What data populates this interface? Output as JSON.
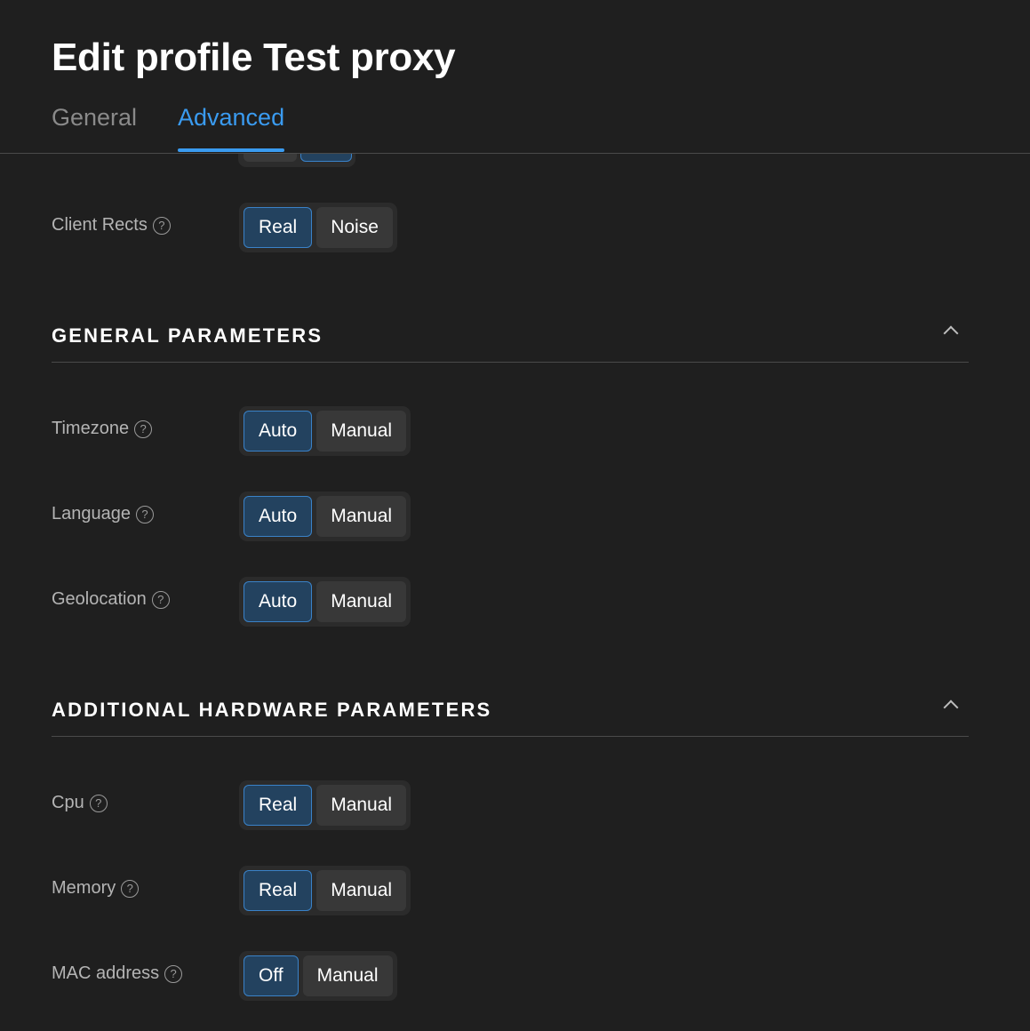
{
  "header": {
    "title": "Edit profile Test proxy",
    "tabs": [
      {
        "label": "General",
        "active": false
      },
      {
        "label": "Advanced",
        "active": true
      }
    ]
  },
  "colors": {
    "accent": "#3a9bf0",
    "active_button_bg": "#23425f",
    "active_button_border": "#3a82c8",
    "background": "#1f1f1f"
  },
  "rows_top": {
    "client_rects": {
      "label": "Client Rects",
      "options": [
        "Real",
        "Noise"
      ],
      "selected": "Real"
    }
  },
  "general_parameters": {
    "title": "GENERAL PARAMETERS",
    "expanded": true,
    "rows": {
      "timezone": {
        "label": "Timezone",
        "options": [
          "Auto",
          "Manual"
        ],
        "selected": "Auto"
      },
      "language": {
        "label": "Language",
        "options": [
          "Auto",
          "Manual"
        ],
        "selected": "Auto"
      },
      "geolocation": {
        "label": "Geolocation",
        "options": [
          "Auto",
          "Manual"
        ],
        "selected": "Auto"
      }
    }
  },
  "hardware_parameters": {
    "title": "ADDITIONAL HARDWARE PARAMETERS",
    "expanded": true,
    "rows": {
      "cpu": {
        "label": "Cpu",
        "options": [
          "Real",
          "Manual"
        ],
        "selected": "Real"
      },
      "memory": {
        "label": "Memory",
        "options": [
          "Real",
          "Manual"
        ],
        "selected": "Real"
      },
      "mac": {
        "label": "MAC address",
        "options": [
          "Off",
          "Manual"
        ],
        "selected": "Off"
      }
    }
  },
  "icons": {
    "help": "?"
  }
}
